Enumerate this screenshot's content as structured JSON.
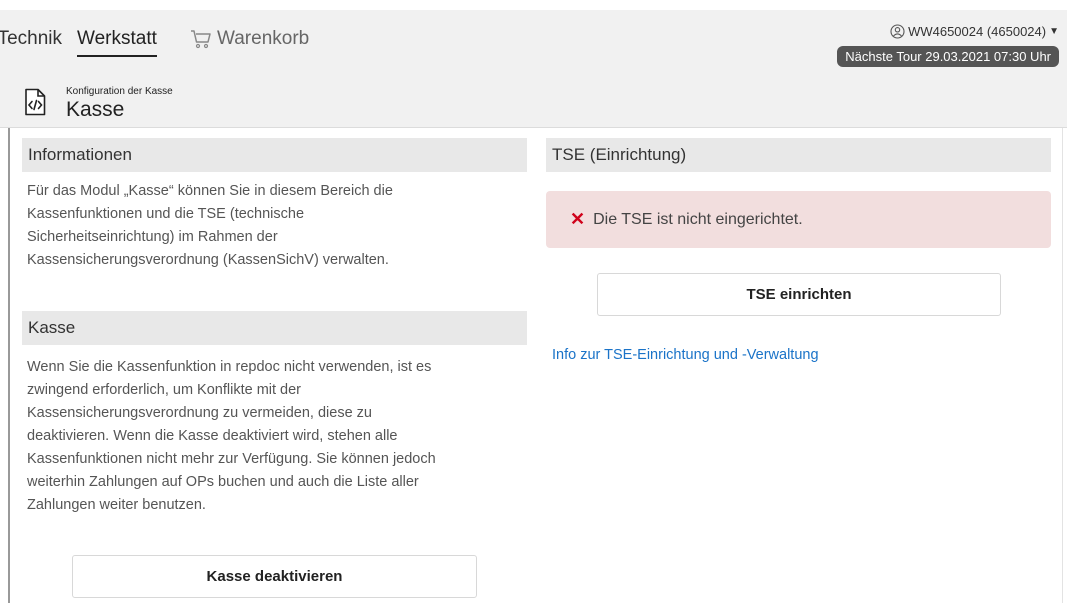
{
  "nav": {
    "cut_tab": "Technik",
    "active_tab": "Werkstatt",
    "cart_tab": "Warenkorb",
    "cart_icon": "cart-icon"
  },
  "user": {
    "label": "WW4650024 (4650024)",
    "dropdown_glyph": "▼",
    "icon": "user-circle-icon"
  },
  "tour": {
    "label": "Nächste Tour 29.03.2021 07:30 Uhr"
  },
  "page": {
    "icon": "code-file-icon",
    "subtitle": "Konfiguration der Kasse",
    "title": "Kasse"
  },
  "left": {
    "info_title": "Informationen",
    "info_lines": [
      "Für das Modul „Kasse“ können Sie in diesem Bereich die",
      "Kassenfunktionen und die TSE (technische",
      "Sicherheitseinrichtung) im Rahmen der",
      "Kassensicherungsverordnung (KassenSichV) verwalten."
    ],
    "kasse_title": "Kasse",
    "kasse_lines": [
      "Wenn Sie die Kassenfunktion in repdoc nicht verwenden, ist es",
      "zwingend erforderlich, um Konflikte mit der",
      "Kassensicherungsverordnung zu vermeiden, diese zu",
      "deaktivieren. Wenn die Kasse deaktiviert wird, stehen alle",
      "Kassenfunktionen nicht mehr zur Verfügung. Sie können jedoch",
      "weiterhin Zahlungen auf OPs buchen und auch die Liste aller",
      "Zahlungen weiter benutzen."
    ],
    "deactivate_button": "Kasse deaktivieren"
  },
  "right": {
    "tse_title": "TSE (Einrichtung)",
    "alert_glyph": "✕",
    "alert_text": "Die TSE ist nicht eingerichtet.",
    "setup_button": "TSE einrichten",
    "info_link": "Info zur TSE-Einrichtung und -Verwaltung"
  },
  "colors": {
    "header_bg": "#f1f1f1",
    "section_bg": "#e8e8e8",
    "pill_bg": "#555555",
    "alert_bg": "#f2dede",
    "error_red": "#d0021b",
    "link_blue": "#1a73c8"
  }
}
